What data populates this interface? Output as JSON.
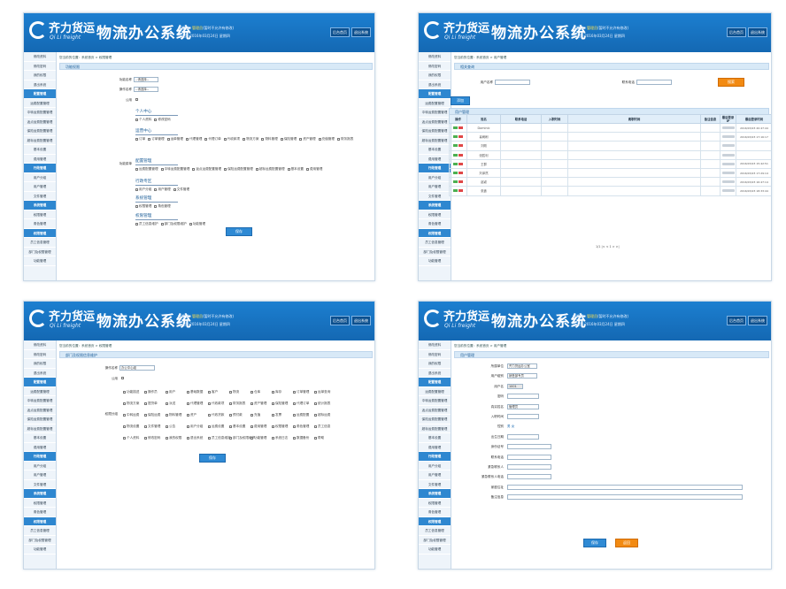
{
  "header": {
    "brand_cn": "齐力货运",
    "brand_en": "Qi Li freight",
    "system_title": "物流办公系统",
    "user_line1_prefix": "欢迎您：",
    "user_name": "管理员",
    "user_line1_suffix": "(暂时不允许有修改)",
    "user_line2": "今天是 2016年03月24日 星期四",
    "btn_home": "后台首页",
    "btn_exit": "退出系统"
  },
  "sidebar": [
    {
      "label": "修改资料",
      "group": false
    },
    {
      "label": "修改密码",
      "group": false
    },
    {
      "label": "我的权限",
      "group": false
    },
    {
      "label": "退出系统",
      "group": false
    },
    {
      "label": "配置管理",
      "group": true
    },
    {
      "label": "运费配置管理",
      "group": false
    },
    {
      "label": "中转运费配置管理",
      "group": false
    },
    {
      "label": "返点运费配置管理",
      "group": false
    },
    {
      "label": "保险运费配置管理",
      "group": false
    },
    {
      "label": "超标运费配置管理",
      "group": false
    },
    {
      "label": "基本设置",
      "group": false
    },
    {
      "label": "费用管理",
      "group": false
    },
    {
      "label": "行政管理",
      "group": true
    },
    {
      "label": "用户分组",
      "group": false
    },
    {
      "label": "用户管理",
      "group": false
    },
    {
      "label": "文件管理",
      "group": false
    },
    {
      "label": "系统管理",
      "group": true
    },
    {
      "label": "权限管理",
      "group": false
    },
    {
      "label": "角色管理",
      "group": false
    },
    {
      "label": "权限管理",
      "group": true
    },
    {
      "label": "员工信息管理",
      "group": false
    },
    {
      "label": "部门及权限管理",
      "group": false
    },
    {
      "label": "功能管理",
      "group": false
    }
  ],
  "p1": {
    "crumb": "您当前的位置：系统首页 > 权限管理",
    "section": "功能权限",
    "lbl_func_name": "功能名称",
    "sel_func_name": "--请选择--",
    "lbl_op_name": "操作名称",
    "sel_op_name": "--请选择--",
    "lbl_public": "公用",
    "lbl_menu": "功能菜单",
    "groups": [
      {
        "title": "个人中心",
        "items": [
          "个人资料",
          "修改密码"
        ]
      },
      {
        "title": "运营中心",
        "items": [
          "订单",
          "订单管理",
          "运单管理",
          "代理管理",
          "代理订单",
          "代收款项",
          "物流方案",
          "物料管理",
          "保险管理",
          "资产管理",
          "充值管理",
          "财务报表"
        ]
      },
      {
        "title": "配置管理",
        "items": [
          "运费配置管理",
          "中转运费配置管理",
          "返点运费配置管理",
          "保险运费配置管理",
          "超标运费配置管理",
          "基本设置",
          "费用管理"
        ]
      },
      {
        "title": "行政专区",
        "items": [
          "用户分组",
          "用户管理",
          "文件管理"
        ]
      },
      {
        "title": "系统管理",
        "items": [
          "权限管理",
          "角色管理"
        ]
      },
      {
        "title": "权限管理",
        "items": [
          "员工信息维护",
          "部门及权限维护",
          "功能管理"
        ]
      }
    ],
    "save": "保存"
  },
  "p2": {
    "crumb": "您当前的位置：系统首页 > 用户管理",
    "section": "相关查询",
    "lbl_user": "用户名称",
    "lbl_contact": "联系电话",
    "btn_search": "搜索",
    "btn_add": "添加",
    "section2": "用户管理",
    "cols": [
      "操作",
      "姓名",
      "联系电话",
      "入职时间",
      "离职时间",
      "备注信息",
      "最后登录IP",
      "最后登录时间"
    ],
    "rows": [
      {
        "name": "Dominic",
        "time": "2016/03/23 20:47:44"
      },
      {
        "name": "喜刷刷",
        "time": "2016/03/23 17:16:17"
      },
      {
        "name": "刘刚",
        "time": ""
      },
      {
        "name": "张胜利",
        "time": ""
      },
      {
        "name": "王群",
        "time": "2016/03/23 15:42:51"
      },
      {
        "name": "刘泽然",
        "time": "2016/03/23 17:29:14"
      },
      {
        "name": "赵颖",
        "time": "2016/03/23 16:47:14"
      },
      {
        "name": "张鑫",
        "time": "2016/03/23 18:33:44"
      }
    ],
    "pager": "1/1 |< < 1 > >|"
  },
  "p3": {
    "crumb": "您当前的位置：系统首页 > 权限管理",
    "section": "部门及权限信息维护",
    "lbl_op_name": "操作名称",
    "sel_op_name": "办公中心组",
    "lbl_public": "公用",
    "lbl_perm": "权限分组",
    "perms": [
      "功能描述",
      "操作员",
      "用户",
      "基础数据",
      "客户",
      "物流",
      "仓库",
      "库存",
      "订单管理",
      "运单查询",
      "物流方案",
      "提货单",
      "派送",
      "代理管理",
      "代收款项",
      "财务报表",
      "资产管理",
      "保险管理",
      "代理订单",
      "统计报表",
      "中转运费",
      "保险运费",
      "物料管理",
      "资产",
      "代收货款",
      "预付款",
      "充值",
      "发票",
      "运费配置",
      "超标运费",
      "物流设置",
      "文件管理",
      "公告",
      "用户分组",
      "运费设置",
      "基本设置",
      "费用管理",
      "权限管理",
      "角色管理",
      "员工信息",
      "个人资料",
      "修改密码",
      "我的权限",
      "退出系统",
      "员工信息维护",
      "部门及权限维护",
      "功能管理",
      "系统日志",
      "数据备份",
      "帮助"
    ],
    "save": "保存"
  },
  "p4": {
    "crumb": "您当前的位置：系统首页 > 用户管理",
    "section": "用户管理",
    "lbl_dept": "所属单位",
    "sel_dept": "齐力货运办公室",
    "lbl_group": "用户组别",
    "sel_group": "销售部专员",
    "lbl_account": "用户名",
    "val_account": "1001",
    "lbl_pwd": "密码",
    "lbl_name": "真实姓名",
    "val_name": "管理员",
    "lbl_join": "入职时间",
    "lbl_gender": "性别",
    "val_gender": "男  女",
    "lbl_birthday": "出生日期",
    "lbl_idcard": "身份证号",
    "lbl_phone": "联系电话",
    "lbl_emg": "紧急联系人",
    "lbl_emg_phone": "紧急联系人电话",
    "lbl_addr": "家庭住址",
    "lbl_remark": "备注信息",
    "save": "保存",
    "back": "返回"
  }
}
